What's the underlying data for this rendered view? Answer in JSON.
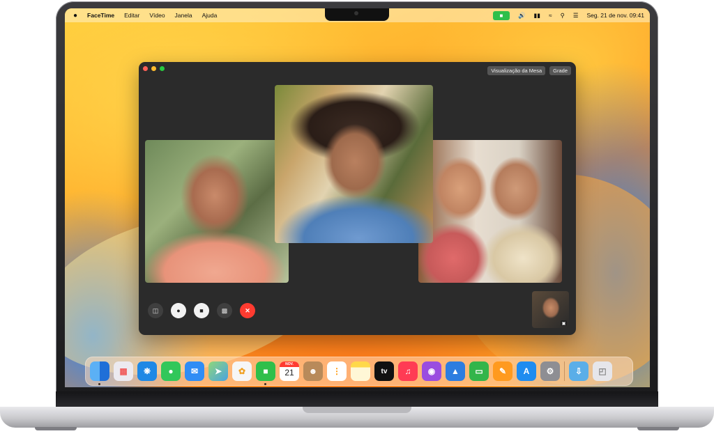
{
  "menubar": {
    "app_name": "FaceTime",
    "menus": [
      "Editar",
      "Vídeo",
      "Janela",
      "Ajuda"
    ],
    "date_time": "Seg. 21 de nov.  09:41"
  },
  "facetime": {
    "view_buttons": [
      "Visualização da Mesa",
      "Grade"
    ],
    "controls": [
      {
        "icon": "sidebar-icon"
      },
      {
        "icon": "microphone-icon"
      },
      {
        "icon": "video-camera-icon"
      },
      {
        "icon": "shareplay-icon"
      },
      {
        "icon": "end-call-icon",
        "glyph": "✕"
      }
    ]
  },
  "dock": {
    "items": [
      {
        "name": "finder",
        "color": "#3d8ef0",
        "running": true
      },
      {
        "name": "launchpad",
        "color": "#e8e8ee"
      },
      {
        "name": "safari",
        "color": "#1e88e5"
      },
      {
        "name": "messages",
        "color": "#32c75a"
      },
      {
        "name": "mail",
        "color": "#2f8df5"
      },
      {
        "name": "maps",
        "color": "#5ac66b"
      },
      {
        "name": "photos",
        "color": "#f4f4f4"
      },
      {
        "name": "facetime",
        "color": "#2fbf4a",
        "running": true
      },
      {
        "name": "calendar",
        "color": "#ffffff",
        "month": "NOV.",
        "day": "21"
      },
      {
        "name": "contacts",
        "color": "#b88a5a"
      },
      {
        "name": "reminders",
        "color": "#ffffff"
      },
      {
        "name": "notes",
        "color": "#ffe27a"
      },
      {
        "name": "tv",
        "color": "#111111",
        "label": "tv"
      },
      {
        "name": "music",
        "color": "#ff3b54"
      },
      {
        "name": "podcasts",
        "color": "#9a4de0"
      },
      {
        "name": "keynote",
        "color": "#2d7de0"
      },
      {
        "name": "numbers",
        "color": "#33b54a"
      },
      {
        "name": "pages",
        "color": "#ff9a1f"
      },
      {
        "name": "app-store",
        "color": "#1f8cf0"
      },
      {
        "name": "system-settings",
        "color": "#8e8e93"
      },
      {
        "name": "downloads-folder",
        "color": "#5aaee8"
      },
      {
        "name": "trash",
        "color": "#e6e6ea"
      }
    ]
  }
}
